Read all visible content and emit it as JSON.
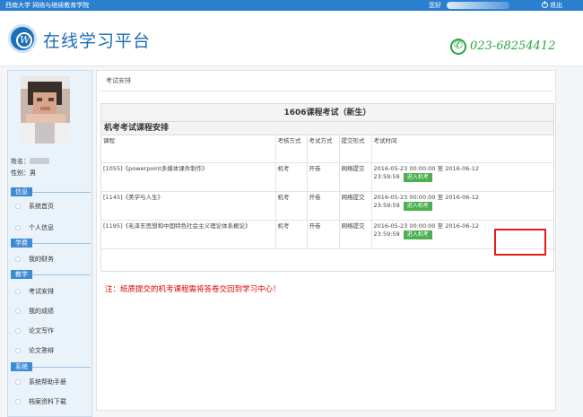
{
  "topbar": {
    "university": "西南大学 网络与继续教育学院",
    "greeting": "您好",
    "logout": "退出"
  },
  "header": {
    "site_title": "在线学习平台",
    "phone": "023-68254412"
  },
  "sidebar": {
    "name_label": "姓名：",
    "gender_label": "性别：",
    "gender_value": "男",
    "sections": [
      {
        "title": "信息",
        "items": [
          "系统首页",
          "个人信息"
        ]
      },
      {
        "title": "学费",
        "items": [
          "我的财务"
        ]
      },
      {
        "title": "教学",
        "items": [
          "考试安排",
          "我的成绩",
          "论文写作",
          "论文答辩"
        ]
      },
      {
        "title": "系统",
        "items": [
          "系统帮助手册",
          "档案资料下载"
        ]
      }
    ]
  },
  "breadcrumb": "考试安排",
  "card": {
    "title": "1606课程考试（新生）",
    "subtitle": "机考考试课程安排",
    "columns": [
      "课程",
      "考核方式",
      "考试方式",
      "提交形式",
      "考试时间"
    ],
    "rows": [
      {
        "course": "[1055]《powerpoint多媒体课件制作》",
        "assess": "机考",
        "mode": "开卷",
        "submit": "网络提交",
        "time_start": "2016-05-23 00:00:00",
        "time_sep": "至",
        "time_end_date": "2016-06-12",
        "time_end_clock": "23:59:59",
        "button": "进入机考"
      },
      {
        "course": "[1145]《美学与人生》",
        "assess": "机考",
        "mode": "开卷",
        "submit": "网络提交",
        "time_start": "2016-05-23 00:00:00",
        "time_sep": "至",
        "time_end_date": "2016-06-12",
        "time_end_clock": "23:59:59",
        "button": "进入机考"
      },
      {
        "course": "[1195]《毛泽东思想和中国特色社会主义理论体系概论》",
        "assess": "机考",
        "mode": "开卷",
        "submit": "网络提交",
        "time_start": "2016-05-23 00:00:00",
        "time_sep": "至",
        "time_end_date": "2016-06-12",
        "time_end_clock": "23:59:59",
        "button": "进入机考"
      }
    ],
    "note": "注：纸质提交的机考课程需将答卷交回到学习中心！"
  },
  "colors": {
    "topbar": "#2b7fcf",
    "brand_blue": "#1b6bb5",
    "phone_green": "#27a63f",
    "button_green": "#4caf50",
    "note_red": "#e00000",
    "highlight_red": "#e21c1c"
  }
}
